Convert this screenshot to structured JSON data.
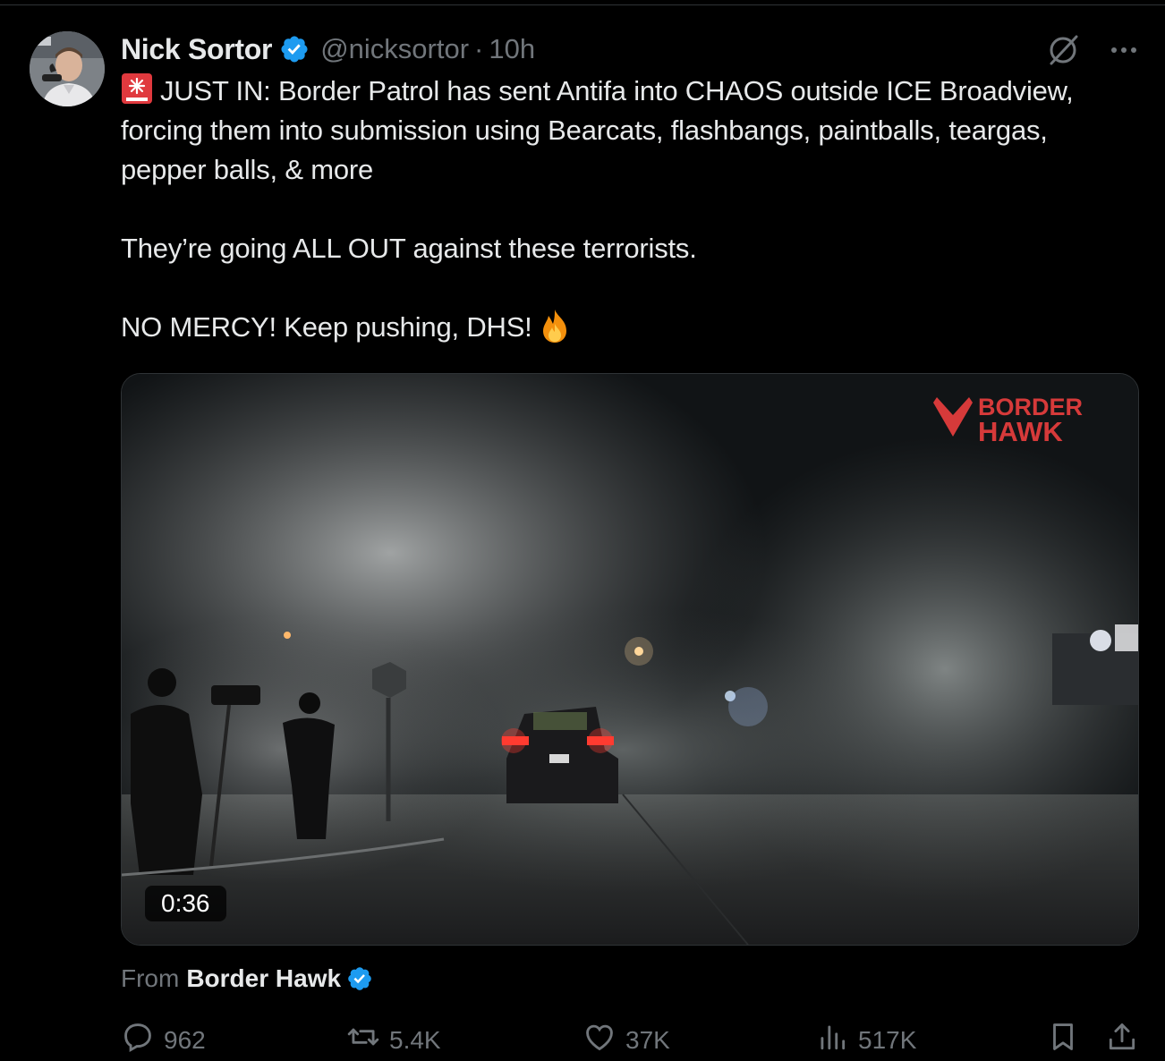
{
  "author": {
    "name": "Nick Sortor",
    "handle": "@nicksortor",
    "separator": "·",
    "time": "10h",
    "verified": true
  },
  "post": {
    "line1": "JUST IN: Border Patrol has sent Antifa into CHAOS outside ICE Broadview, forcing them into submission using Bearcats, flashbangs, paintballs, teargas, pepper balls, & more",
    "line2": "They’re going ALL OUT against these terrorists.",
    "line3": "NO MERCY! Keep pushing, DHS!",
    "leading_emoji": "siren-emoji",
    "trailing_emoji": "fire-emoji"
  },
  "media": {
    "type": "video",
    "duration": "0:36",
    "watermark_line1": "BORDER",
    "watermark_line2": "HAWK"
  },
  "attribution": {
    "label": "From",
    "source": "Border Hawk",
    "verified": true
  },
  "actions": {
    "replies": "962",
    "reposts": "5.4K",
    "likes": "37K",
    "views": "517K"
  },
  "icons": {
    "top_right": [
      "grok-icon",
      "more-icon"
    ],
    "actions": [
      "reply-icon",
      "repost-icon",
      "like-icon",
      "views-icon",
      "bookmark-icon",
      "share-icon"
    ]
  },
  "colors": {
    "background": "#000000",
    "text_primary": "#e7e9ea",
    "text_secondary": "#71767b",
    "verified_blue": "#1d9bf0",
    "watermark_red": "#d63a3a"
  }
}
